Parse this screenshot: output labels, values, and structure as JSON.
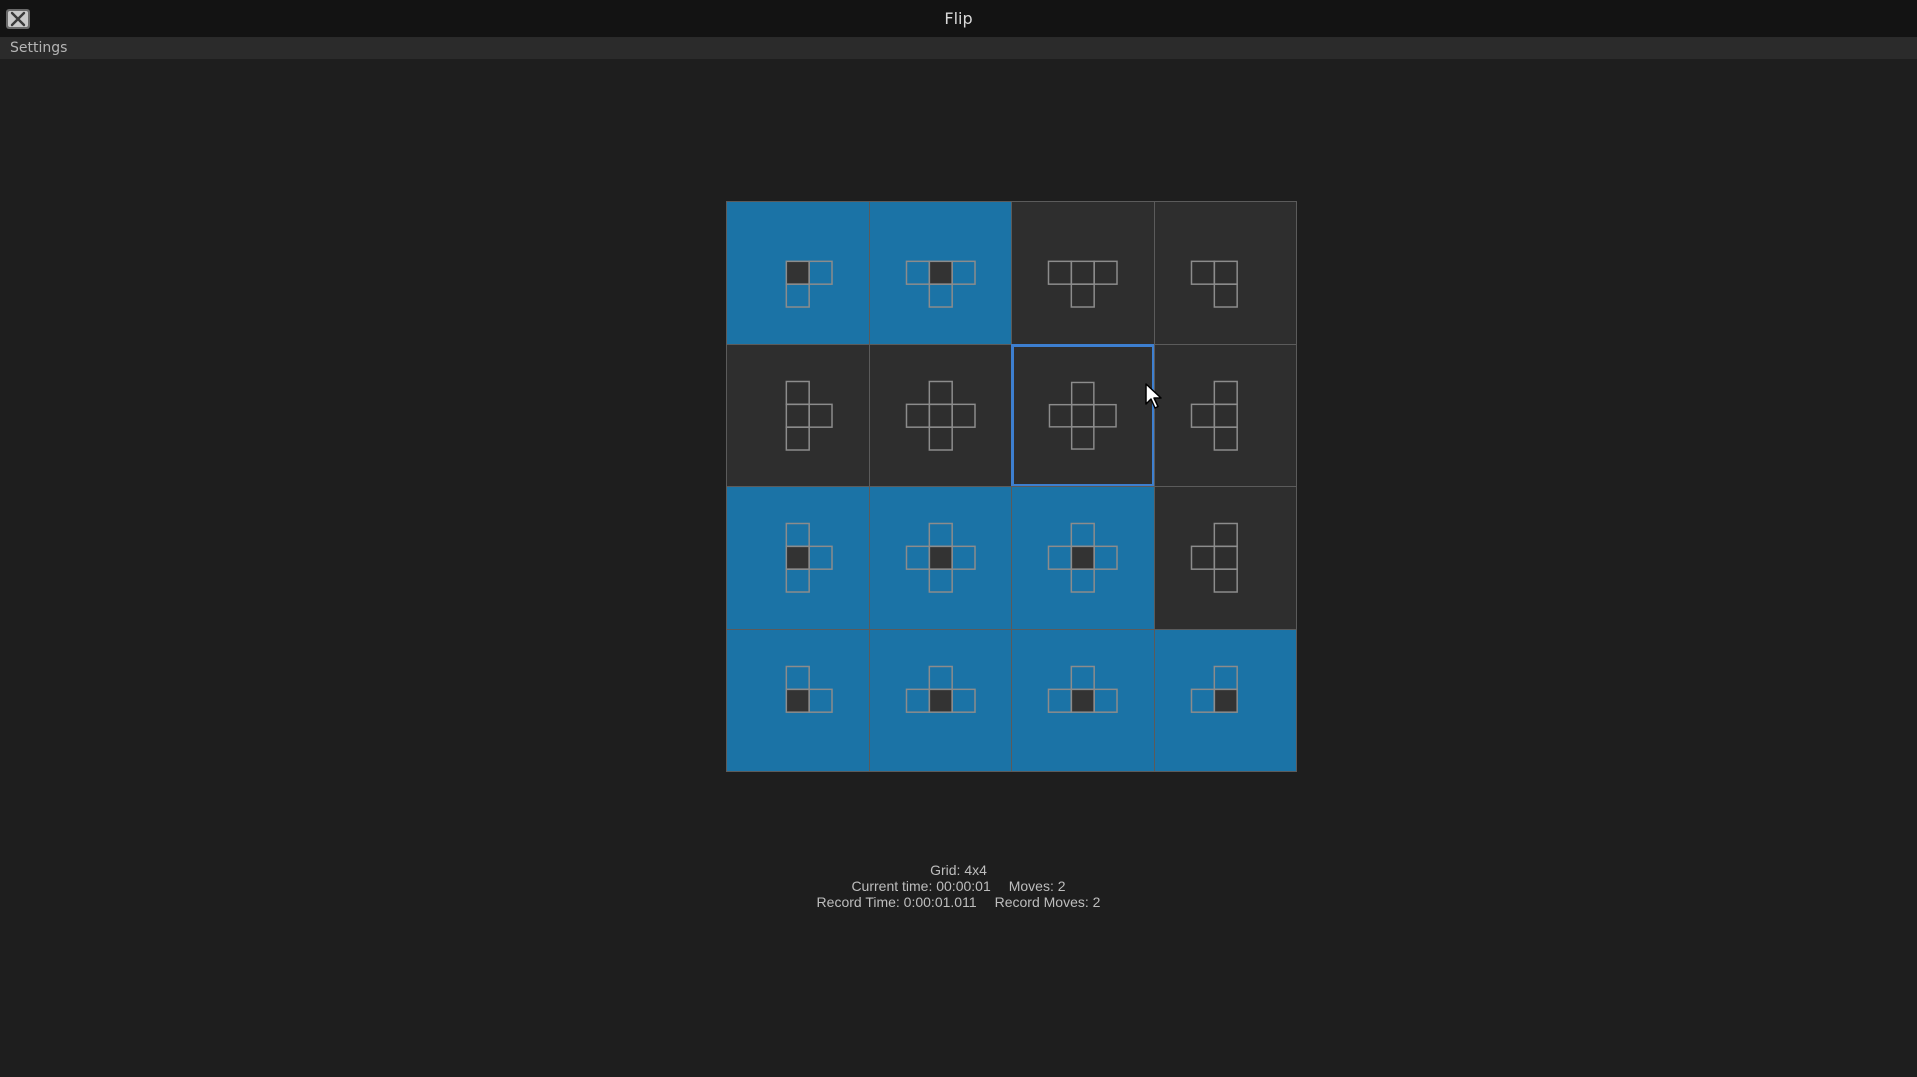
{
  "window": {
    "title": "Flip",
    "app_icon": "x-app-icon"
  },
  "menu": {
    "settings_label": "Settings"
  },
  "board": {
    "rows": 4,
    "cols": 4,
    "colors": {
      "flipped": "#1b73a6",
      "unflipped": "#2e2e2e",
      "focus": "#3d7fd0",
      "pattern_stroke": "#8c8c8c",
      "center_fill": "#333333"
    },
    "focused_tile": {
      "row": 1,
      "col": 2
    },
    "tiles": [
      [
        {
          "flipped": true,
          "pattern": [
            "C",
            "R",
            "D"
          ]
        },
        {
          "flipped": true,
          "pattern": [
            "C",
            "L",
            "R",
            "D"
          ]
        },
        {
          "flipped": false,
          "pattern": [
            "C",
            "L",
            "R",
            "D"
          ]
        },
        {
          "flipped": false,
          "pattern": [
            "C",
            "L",
            "D"
          ]
        }
      ],
      [
        {
          "flipped": false,
          "pattern": [
            "C",
            "U",
            "R",
            "D"
          ]
        },
        {
          "flipped": false,
          "pattern": [
            "C",
            "U",
            "L",
            "R",
            "D"
          ]
        },
        {
          "flipped": false,
          "pattern": [
            "C",
            "U",
            "L",
            "R",
            "D"
          ]
        },
        {
          "flipped": false,
          "pattern": [
            "C",
            "U",
            "L",
            "D"
          ]
        }
      ],
      [
        {
          "flipped": true,
          "pattern": [
            "C",
            "U",
            "R",
            "D"
          ]
        },
        {
          "flipped": true,
          "pattern": [
            "C",
            "U",
            "L",
            "R",
            "D"
          ]
        },
        {
          "flipped": true,
          "pattern": [
            "C",
            "U",
            "L",
            "R",
            "D"
          ]
        },
        {
          "flipped": false,
          "pattern": [
            "C",
            "U",
            "L",
            "D"
          ]
        }
      ],
      [
        {
          "flipped": true,
          "pattern": [
            "C",
            "U",
            "R"
          ]
        },
        {
          "flipped": true,
          "pattern": [
            "C",
            "U",
            "L",
            "R"
          ]
        },
        {
          "flipped": true,
          "pattern": [
            "C",
            "U",
            "L",
            "R"
          ]
        },
        {
          "flipped": true,
          "pattern": [
            "C",
            "U",
            "L"
          ]
        }
      ]
    ]
  },
  "status": {
    "grid": "Grid: 4x4",
    "current_time": "Current time: 00:00:01",
    "moves": "Moves: 2",
    "record_time": "Record Time: 0:00:01.011",
    "record_moves": "Record Moves: 2"
  }
}
